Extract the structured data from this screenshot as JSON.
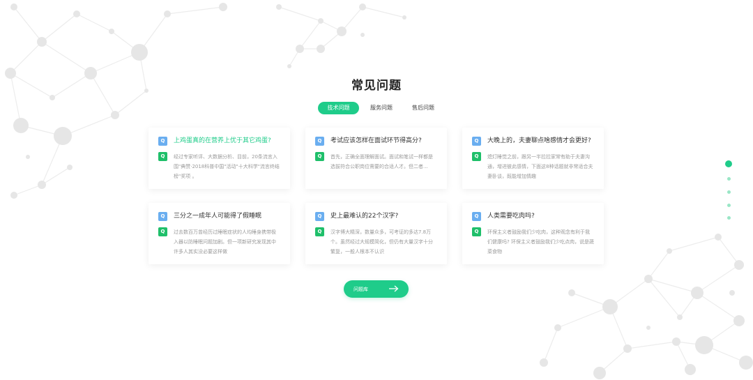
{
  "page": {
    "title": "常见问题"
  },
  "tabs": [
    {
      "label": "技术问题",
      "active": true
    },
    {
      "label": "服务问题",
      "active": false
    },
    {
      "label": "售后问题",
      "active": false
    }
  ],
  "badges": {
    "question": "Q",
    "answer": "Q"
  },
  "cards": [
    {
      "question": "上鸡蛋真的在营养上优于其它鸡蛋?",
      "answer": "经过专家听评、大数据分析、目前，20条流言入围\"典赞·2018科普中国\"活动\"十大科学\"流言终结榜\"奖项 。",
      "highlight": true
    },
    {
      "question": "考试应该怎样在面试环节得高分?",
      "answer": "首先，正确全面理解面试。面试和笔试一样都是选拔符合公职岗位需要的合适人才。但二者...",
      "highlight": false
    },
    {
      "question": "大晚上的，夫妻聊点啥感情才会更好?",
      "answer": "熄灯睡觉之前，跟另一半拉拉家常有助于夫妻沟通，增进彼此感情，下面这8种话题就非常适合夫妻卧谈，既能增加情趣",
      "highlight": false
    },
    {
      "question": "三分之一成年人可能得了假睡眠",
      "answer": "过去数百万曾经历过睡眠症状的人均睡身携带极入器以防睡眠问题加剧。但一项新研究发现其中许多人其实没必要这样做",
      "highlight": false
    },
    {
      "question": "史上最难认的22个汉字?",
      "answer": "汉字博大精深，数量众多，可考证的多达7.8万个。虽然经过大规模简化，但仍有大量汉字十分繁复，一般人根本不认识",
      "highlight": false
    },
    {
      "question": "人类需要吃肉吗?",
      "answer": "环保主义者鼓励我们少吃肉，这种观念有利于我们健康吗? 环保主义者鼓励我们少吃点肉，说是蔬菜食物",
      "highlight": false
    }
  ],
  "more_button": {
    "label": "问题库"
  },
  "side_nav": {
    "active_index": 0,
    "count": 5
  },
  "colors": {
    "accent": "#1fcc8a",
    "question_badge": "#6aaef0",
    "answer_badge": "#1fbf6a",
    "molecule_node": "#e4e4e4",
    "molecule_line": "#ececec"
  },
  "icons": {
    "more_button": "arrow-right-icon",
    "background": "molecule-network"
  }
}
